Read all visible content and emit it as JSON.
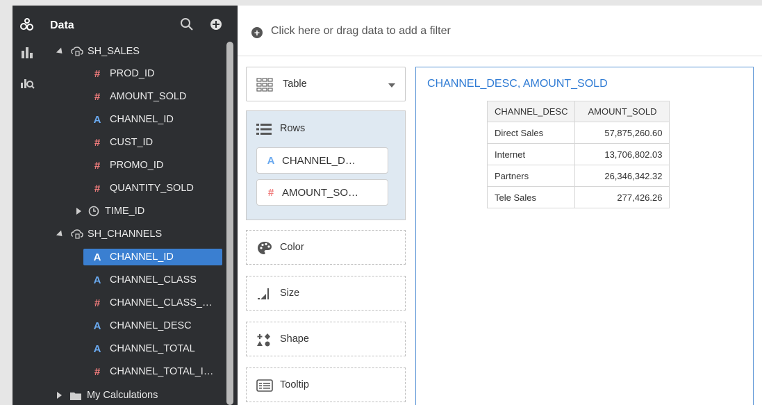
{
  "data_panel": {
    "title": "Data",
    "tree": [
      {
        "label": "SH_SALES",
        "kind": "source"
      },
      {
        "label": "PROD_ID",
        "kind": "measure"
      },
      {
        "label": "AMOUNT_SOLD",
        "kind": "measure"
      },
      {
        "label": "CHANNEL_ID",
        "kind": "attribute"
      },
      {
        "label": "CUST_ID",
        "kind": "measure"
      },
      {
        "label": "PROMO_ID",
        "kind": "measure"
      },
      {
        "label": "QUANTITY_SOLD",
        "kind": "measure"
      },
      {
        "label": "TIME_ID",
        "kind": "time"
      },
      {
        "label": "SH_CHANNELS",
        "kind": "source"
      },
      {
        "label": "CHANNEL_ID",
        "kind": "attribute",
        "selected": true
      },
      {
        "label": "CHANNEL_CLASS",
        "kind": "attribute"
      },
      {
        "label": "CHANNEL_CLASS_…",
        "kind": "measure"
      },
      {
        "label": "CHANNEL_DESC",
        "kind": "attribute"
      },
      {
        "label": "CHANNEL_TOTAL",
        "kind": "attribute"
      },
      {
        "label": "CHANNEL_TOTAL_I…",
        "kind": "measure"
      },
      {
        "label": "My Calculations",
        "kind": "folder"
      }
    ]
  },
  "filter_bar": {
    "text": "Click here or drag data to add a filter"
  },
  "grammar": {
    "viz_type": "Table",
    "rows_label": "Rows",
    "rows": [
      {
        "label": "CHANNEL_D…",
        "kind": "attribute"
      },
      {
        "label": "AMOUNT_SO…",
        "kind": "measure"
      }
    ],
    "color_label": "Color",
    "size_label": "Size",
    "shape_label": "Shape",
    "tooltip_label": "Tooltip"
  },
  "canvas": {
    "title": "CHANNEL_DESC, AMOUNT_SOLD",
    "columns": [
      "CHANNEL_DESC",
      "AMOUNT_SOLD"
    ],
    "rows": [
      [
        "Direct Sales",
        "57,875,260.60"
      ],
      [
        "Internet",
        "13,706,802.03"
      ],
      [
        "Partners",
        "26,346,342.32"
      ],
      [
        "Tele Sales",
        "277,426.26"
      ]
    ]
  },
  "colors": {
    "panel_bg": "#2d2f32",
    "accent_blue": "#3a7fd1",
    "measure_icon": "#f07c7c",
    "attribute_icon": "#6aa9ef",
    "title_blue": "#2f7bd4"
  },
  "icons": {
    "sidebar": [
      "data-sources-icon",
      "visualizations-icon",
      "analytics-icon"
    ],
    "panel": [
      "search-icon",
      "add-icon"
    ]
  }
}
